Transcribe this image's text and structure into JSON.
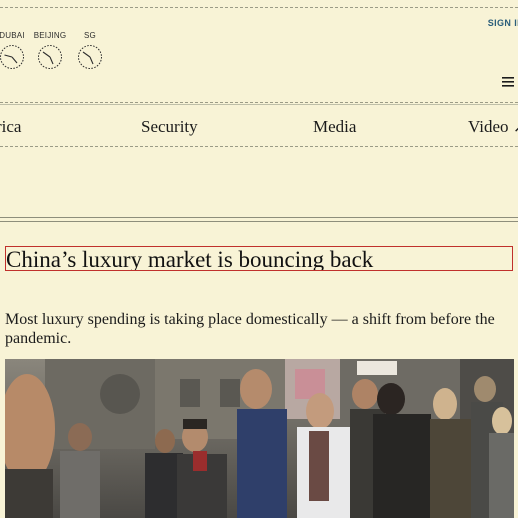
{
  "header": {
    "clocks": [
      {
        "city": "DUBAI",
        "hour_angle": 250,
        "minute_angle": 120
      },
      {
        "city": "BEIJING",
        "hour_angle": 300,
        "minute_angle": 130
      },
      {
        "city": "SG",
        "hour_angle": 300,
        "minute_angle": 130
      }
    ],
    "sign_in_label": "SIGN IN",
    "menu_icon": "hamburger-icon"
  },
  "nav": {
    "items": [
      {
        "label": "Africa"
      },
      {
        "label": "Security"
      },
      {
        "label": "Media"
      },
      {
        "label": "Video ↗"
      }
    ]
  },
  "article": {
    "headline": "China’s luxury market is bouncing back",
    "deck": "Most luxury spending is taking place domestically — a shift from before the pandemic.",
    "image_alt": "Shoppers walking on a busy street"
  },
  "colors": {
    "background": "#f8f3d6",
    "link": "#2a5d7a",
    "highlight_border": "#c0302c"
  }
}
